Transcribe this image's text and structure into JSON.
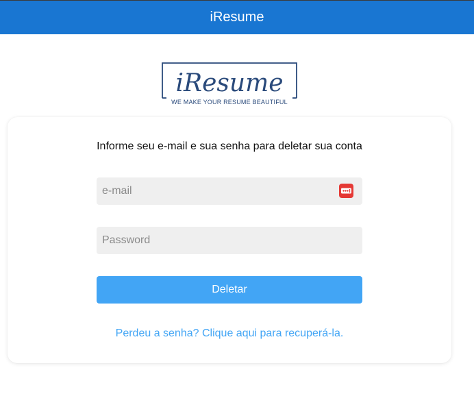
{
  "header": {
    "title": "iResume"
  },
  "logo": {
    "wordmark": "iResume",
    "tagline": "WE MAKE YOUR RESUME BEAUTIFUL"
  },
  "form": {
    "instructions": "Informe seu e-mail e sua senha para deletar sua conta",
    "email": {
      "placeholder": "e-mail",
      "value": ""
    },
    "password": {
      "placeholder": "Password",
      "value": ""
    },
    "submit_label": "Deletar",
    "recover_link": "Perdeu a senha? Clique aqui para recuperá-la."
  },
  "colors": {
    "header_bg": "#1976d2",
    "button_bg": "#42a5f5",
    "link": "#42a5f5",
    "logo": "#2a4a7b",
    "autofill_icon": "#e53935"
  },
  "icons": {
    "email_field_icon": "password-manager-icon"
  }
}
